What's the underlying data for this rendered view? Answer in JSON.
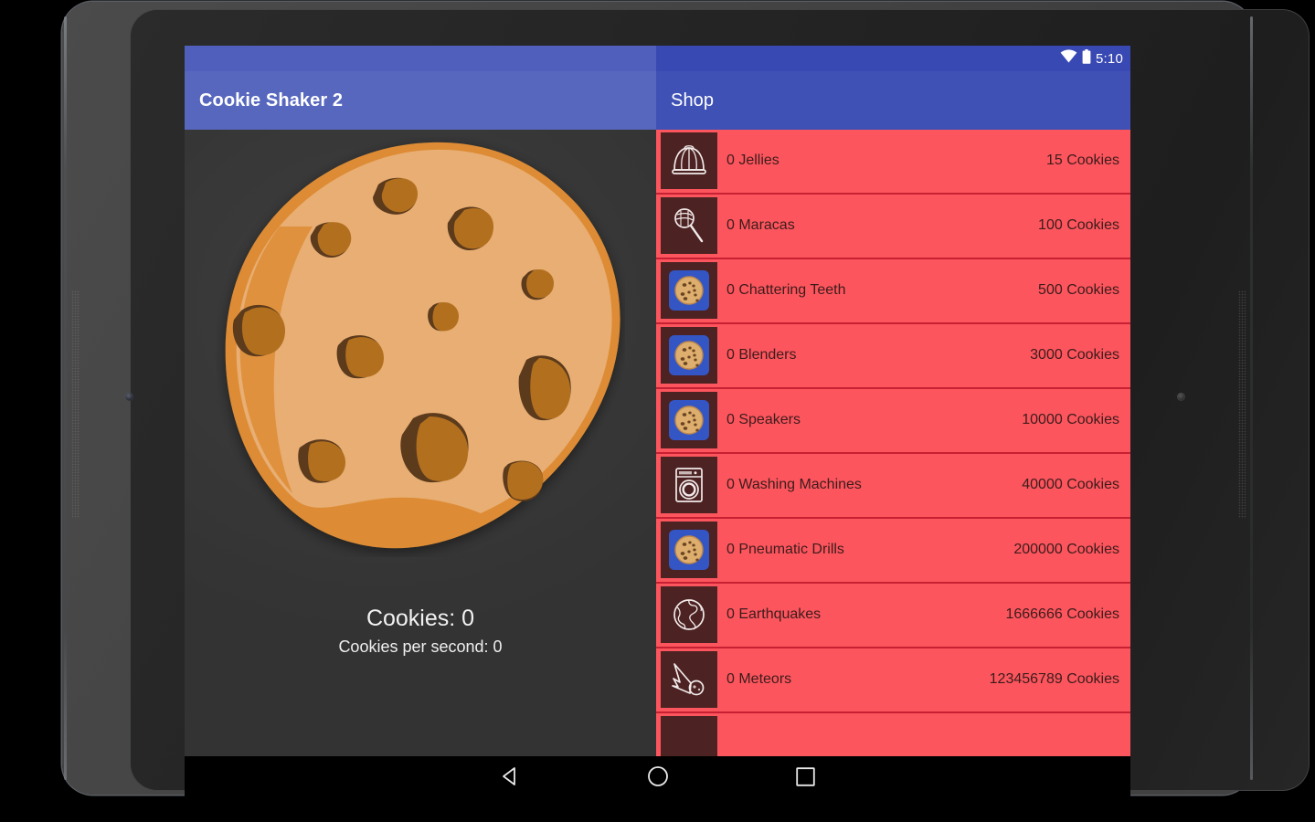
{
  "device": {
    "type": "android-tablet",
    "left_camera": "camera-dot",
    "right_camera": "camera-dot"
  },
  "status_bar": {
    "clock": "5:10",
    "wifi_icon": "wifi-icon",
    "battery_icon": "battery-full-icon",
    "background_color": "#3949b3"
  },
  "app_bar": {
    "app_title": "Cookie Shaker 2",
    "shop_title": "Shop",
    "background_color": "#3f51b5"
  },
  "clicker": {
    "cookie_icon": "cookie-button",
    "cookie_count_label": "Cookies: 0",
    "cookies_per_second_label": "Cookies per second: 0",
    "background_color": "#3a3a3a",
    "cookie_body_color": "#e6ab70",
    "cookie_rim_color": "#dd8c35",
    "cookie_chip_color": "#b5712a",
    "cookie_chip_shadow_color": "#5a3a1c"
  },
  "shop": {
    "background_color": "#c62032",
    "row_color": "#fc555d",
    "row_icon_background": "#4c2222",
    "row_text_color": "#3c1c1c",
    "items": [
      {
        "icon": "jelly-icon",
        "label": "0 Jellies",
        "price": "15 Cookies"
      },
      {
        "icon": "maraca-icon",
        "label": "0 Maracas",
        "price": "100 Cookies"
      },
      {
        "icon": "cookie-tile-icon",
        "label": "0 Chattering Teeth",
        "price": "500 Cookies"
      },
      {
        "icon": "cookie-tile-icon",
        "label": "0 Blenders",
        "price": "3000 Cookies"
      },
      {
        "icon": "cookie-tile-icon",
        "label": "0 Speakers",
        "price": "10000 Cookies"
      },
      {
        "icon": "washing-machine-icon",
        "label": "0 Washing Machines",
        "price": "40000 Cookies"
      },
      {
        "icon": "cookie-tile-icon",
        "label": "0 Pneumatic Drills",
        "price": "200000 Cookies"
      },
      {
        "icon": "globe-icon",
        "label": "0 Earthquakes",
        "price": "1666666 Cookies"
      },
      {
        "icon": "meteor-icon",
        "label": "0 Meteors",
        "price": "123456789 Cookies"
      },
      {
        "icon": "cookie-tile-icon",
        "label": "",
        "price": ""
      }
    ]
  },
  "nav_bar": {
    "back_icon": "back-triangle-icon",
    "home_icon": "home-circle-icon",
    "recents_icon": "recents-square-icon",
    "background_color": "#000000"
  }
}
